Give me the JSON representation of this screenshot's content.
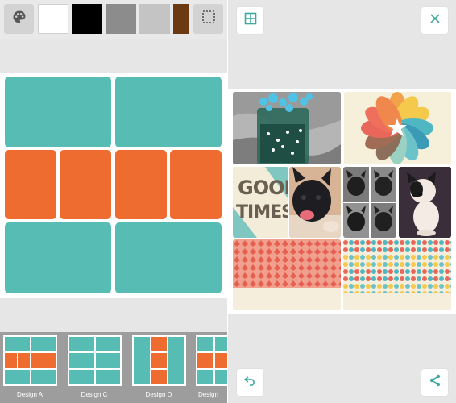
{
  "left_panel": {
    "toolbar": {
      "palette_icon": "palette-icon",
      "crop_icon": "crop-frame-icon",
      "swatches": [
        {
          "name": "white",
          "color": "#ffffff"
        },
        {
          "name": "black",
          "color": "#000000"
        },
        {
          "name": "gray",
          "color": "#8c8c8c"
        },
        {
          "name": "light-gray",
          "color": "#c4c4c4"
        },
        {
          "name": "brown",
          "color": "#6b3a12"
        }
      ]
    },
    "colors": {
      "teal": "#57bdb4",
      "orange": "#ef6c30"
    },
    "designs": [
      {
        "label": "Design A"
      },
      {
        "label": "Design C"
      },
      {
        "label": "Design D"
      },
      {
        "label": "Design"
      }
    ]
  },
  "right_panel": {
    "grid_icon": "grid-icon",
    "close_icon": "close-icon",
    "undo_icon": "undo-icon",
    "share_icon": "share-icon",
    "collage": {
      "poster_text": [
        "GOOD",
        "TIMES"
      ]
    }
  }
}
